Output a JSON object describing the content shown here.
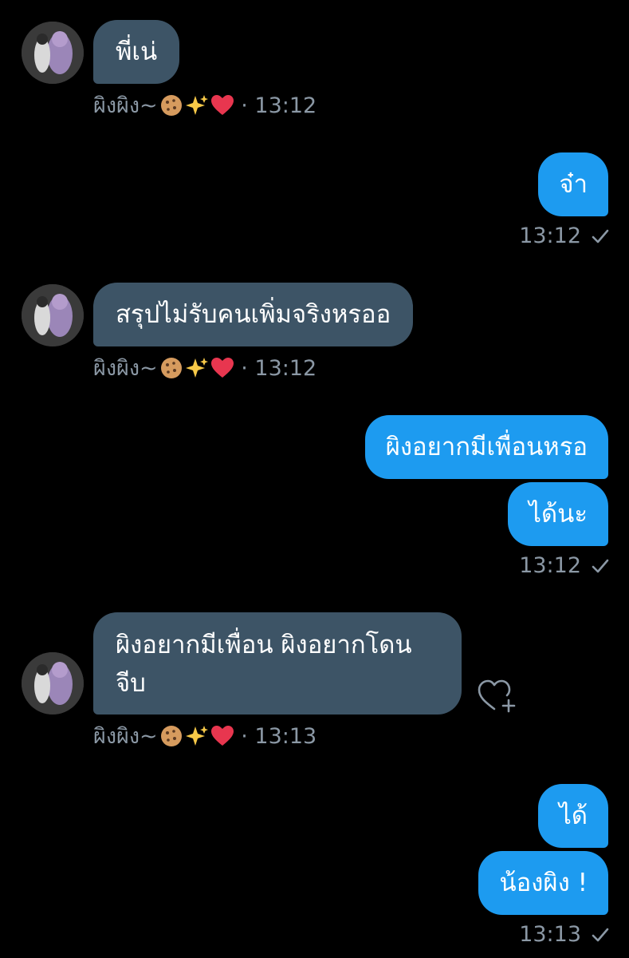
{
  "messages": [
    {
      "text": "พี่เน่"
    },
    {
      "text": "จ๋า"
    },
    {
      "text": "สรุปไม่รับคนเพิ่มจริงหรออ"
    },
    {
      "text": "ผิงอยากมีเพื่อนหรอ"
    },
    {
      "text": "ได้นะ"
    },
    {
      "text_line1": "ผิงอยากมีเพื่อน ผิงอยากโดน",
      "text_line2": "จีบ"
    },
    {
      "text": "ได้"
    },
    {
      "text": "น้องผิง !"
    }
  ],
  "sender": {
    "name": "ผิงผิง~",
    "emoji_icons": [
      "cookie-icon",
      "sparkles-icon",
      "heart-icon"
    ]
  },
  "meta": {
    "in_1": " · 13:12",
    "out_1": "13:12",
    "in_2": " · 13:12",
    "out_2": "13:12",
    "in_3": " · 13:13",
    "out_3": "13:13"
  },
  "colors": {
    "incoming_bubble": "#3d5466",
    "outgoing_bubble": "#1d9bf0",
    "meta_text": "#8b98a5",
    "background": "#000000"
  }
}
